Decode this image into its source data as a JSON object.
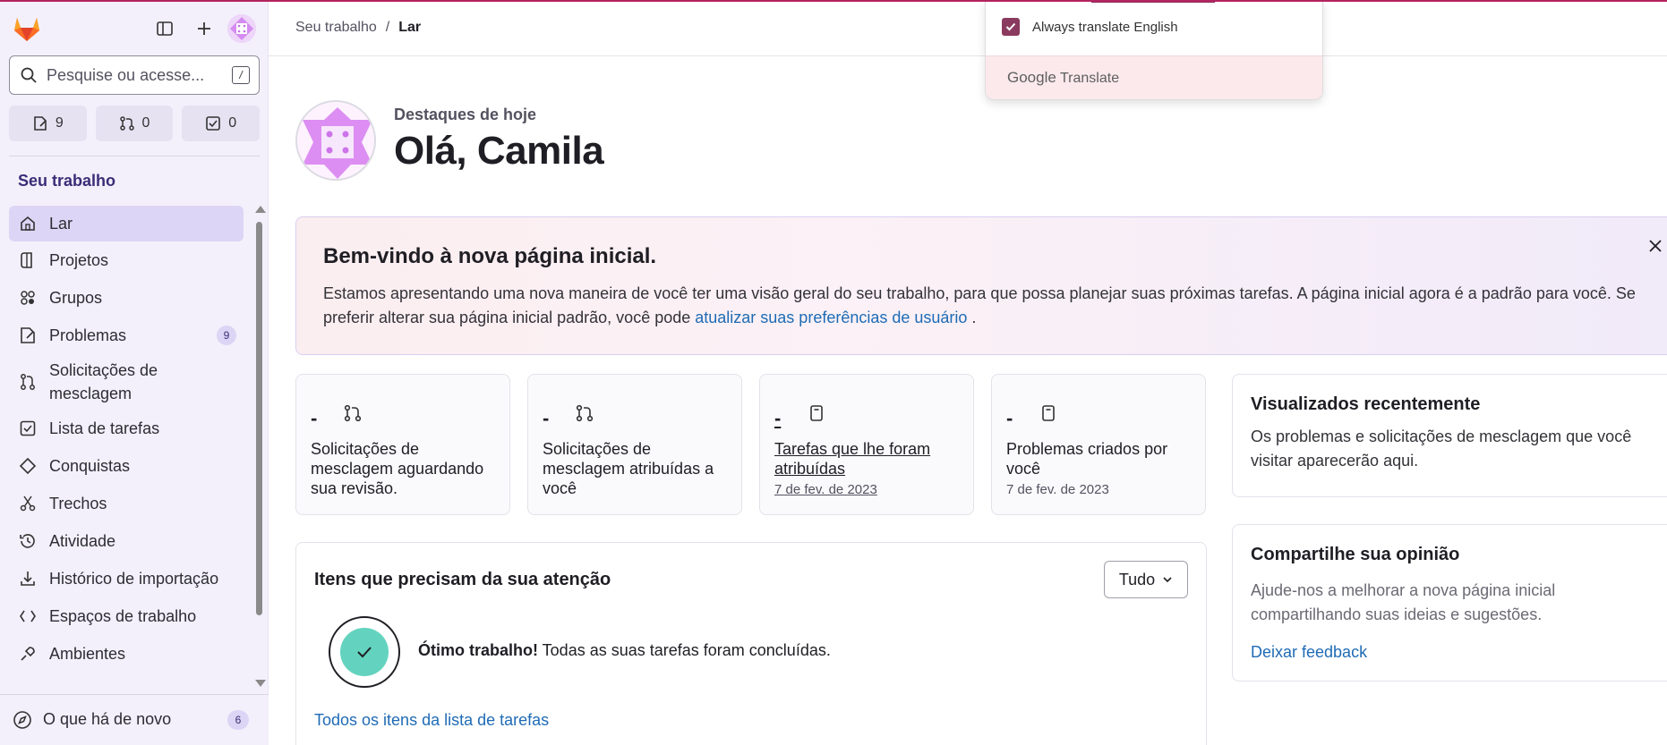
{
  "sidebar": {
    "search_placeholder": "Pesquise ou acesse...",
    "search_shortcut": "/",
    "counters": [
      {
        "icon": "issues-icon",
        "value": "9"
      },
      {
        "icon": "merge-request-icon",
        "value": "0"
      },
      {
        "icon": "todo-icon",
        "value": "0"
      }
    ],
    "section_title": "Seu trabalho",
    "items": [
      {
        "label": "Lar",
        "icon": "home-icon"
      },
      {
        "label": "Projetos",
        "icon": "project-icon"
      },
      {
        "label": "Grupos",
        "icon": "group-icon"
      },
      {
        "label": "Problemas",
        "icon": "issues-icon",
        "badge": "9"
      },
      {
        "label": "Solicitações de mesclagem",
        "icon": "merge-request-icon"
      },
      {
        "label": "Lista de tarefas",
        "icon": "todo-icon"
      },
      {
        "label": "Conquistas",
        "icon": "trophy-icon"
      },
      {
        "label": "Trechos",
        "icon": "snippet-icon"
      },
      {
        "label": "Atividade",
        "icon": "history-icon"
      },
      {
        "label": "Histórico de importação",
        "icon": "import-icon"
      },
      {
        "label": "Espaços de trabalho",
        "icon": "workspace-icon"
      },
      {
        "label": "Ambientes",
        "icon": "environment-icon"
      }
    ],
    "bottom": {
      "label": "O que há de novo",
      "badge": "6",
      "icon": "compass-icon"
    }
  },
  "breadcrumb": {
    "parent": "Seu trabalho",
    "separator": "/",
    "current": "Lar"
  },
  "greeting": {
    "subtitle": "Destaques de hoje",
    "title": "Olá, Camila"
  },
  "banner": {
    "title": "Bem-vindo à nova página inicial.",
    "text": "Estamos apresentando uma nova maneira de você ter uma visão geral do seu trabalho, para que possa planejar suas próximas tarefas. A página inicial agora é a padrão para você. Se preferir alterar sua página inicial padrão, você pode ",
    "link": "atualizar suas preferências de usuário",
    "text_end": " ."
  },
  "cards": [
    {
      "value": "-",
      "icon": "merge-request-icon",
      "label": "Solicitações de mesclagem aguardando sua revisão.",
      "sub": ""
    },
    {
      "value": "-",
      "icon": "merge-request-icon",
      "label": "Solicitações de mesclagem atribuídas a você",
      "sub": ""
    },
    {
      "value": "-",
      "icon": "todo-icon",
      "label": "Tarefas que lhe foram atribuídas",
      "sub": "7 de fev. de 2023"
    },
    {
      "value": "-",
      "icon": "issues-icon",
      "label": "Problemas criados por você",
      "sub": "7 de fev. de 2023"
    }
  ],
  "attention": {
    "title": "Itens que precisam da sua atenção",
    "filter": "Tudo",
    "msg_bold": "Ótimo trabalho!",
    "msg": " Todas as suas tarefas foram concluídas.",
    "link": "Todos os itens da lista de tarefas"
  },
  "recent": {
    "title": "Visualizados recentemente",
    "text": "Os problemas e solicitações de mesclagem que você visitar aparecerão aqui."
  },
  "feedback": {
    "title": "Compartilhe sua opinião",
    "text": "Ajude-nos a melhorar a nova página inicial compartilhando suas ideias e sugestões.",
    "link": "Deixar feedback"
  },
  "translate_popup": {
    "option": "Always translate English",
    "checked": true,
    "brand_google": "Google",
    "brand_translate": "Translate"
  },
  "colors": {
    "accent": "#b3245e",
    "link": "#1f6bb5",
    "sidebar_bg": "#f3f0fb",
    "success": "#63d3bf"
  }
}
